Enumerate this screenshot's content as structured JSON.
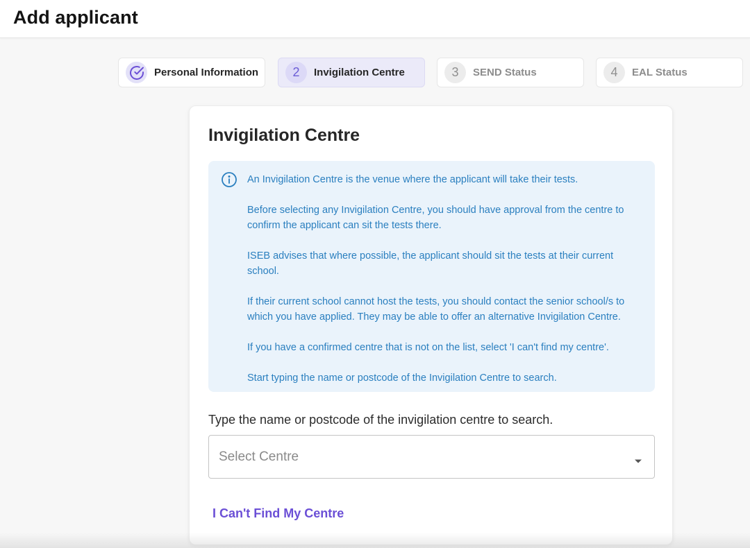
{
  "header": {
    "title": "Add applicant"
  },
  "stepper": {
    "steps": [
      {
        "number": "",
        "label": "Personal Information",
        "state": "completed"
      },
      {
        "number": "2",
        "label": "Invigilation Centre",
        "state": "active"
      },
      {
        "number": "3",
        "label": "SEND Status",
        "state": "upcoming"
      },
      {
        "number": "4",
        "label": "EAL Status",
        "state": "upcoming"
      }
    ]
  },
  "card": {
    "title": "Invigilation Centre",
    "info": {
      "icon": "info-icon",
      "paragraphs": [
        "An Invigilation Centre is the venue where the applicant will take their tests.",
        "Before selecting any Invigilation Centre, you should have approval from the centre to confirm the applicant can sit the tests there.",
        "ISEB advises that where possible, the applicant should sit the tests at their current school.",
        "If their current school cannot host the tests, you should contact the senior school/s to which you have applied. They may be able to offer an alternative Invigilation Centre.",
        "If you have a confirmed centre that is not on the list, select 'I can't find my centre'.",
        "Start typing the name or postcode of the Invigilation Centre to search."
      ]
    },
    "search_label": "Type the name or postcode of the invigilation centre to search.",
    "select": {
      "placeholder": "Select Centre",
      "value": ""
    },
    "cant_find_label": "I Can't Find My Centre"
  },
  "colors": {
    "accent": "#6b4fd6",
    "info_text": "#2a7fbf",
    "info_background": "#eaf3fb",
    "active_step_background": "#ebeaf9"
  }
}
